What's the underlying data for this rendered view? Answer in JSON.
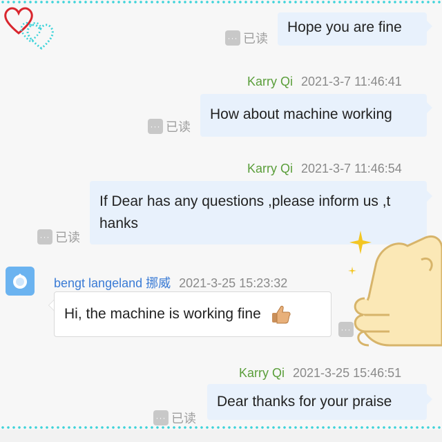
{
  "read_status_label": "已读",
  "read_badge_glyph": "···",
  "colors": {
    "outgoing_bubble": "#e8f1fc",
    "outgoing_sender": "#5a9e3a",
    "incoming_sender": "#3a7bd5",
    "frame_dots": "#3dd3d9"
  },
  "messages": [
    {
      "text": "Hope you are fine"
    },
    {
      "sender": "Karry Qi",
      "timestamp": "2021-3-7 11:46:41",
      "text": "How about machine working"
    },
    {
      "sender": "Karry Qi",
      "timestamp": "2021-3-7 11:46:54",
      "text_line1": "If Dear has any questions ,please inform us ,t",
      "text_line2": "hanks"
    },
    {
      "sender": "bengt langeland 挪威",
      "timestamp": "2021-3-25 15:23:32",
      "text": "Hi, the machine is working fine",
      "emoji": "thumbs-up"
    },
    {
      "sender": "Karry Qi",
      "timestamp": "2021-3-25 15:46:51",
      "text": "Dear thanks for your praise"
    }
  ],
  "icons": [
    "hearts-decoration-icon",
    "avatar-icon",
    "thumbs-up-icon",
    "thumbs-up-sticker-icon"
  ]
}
